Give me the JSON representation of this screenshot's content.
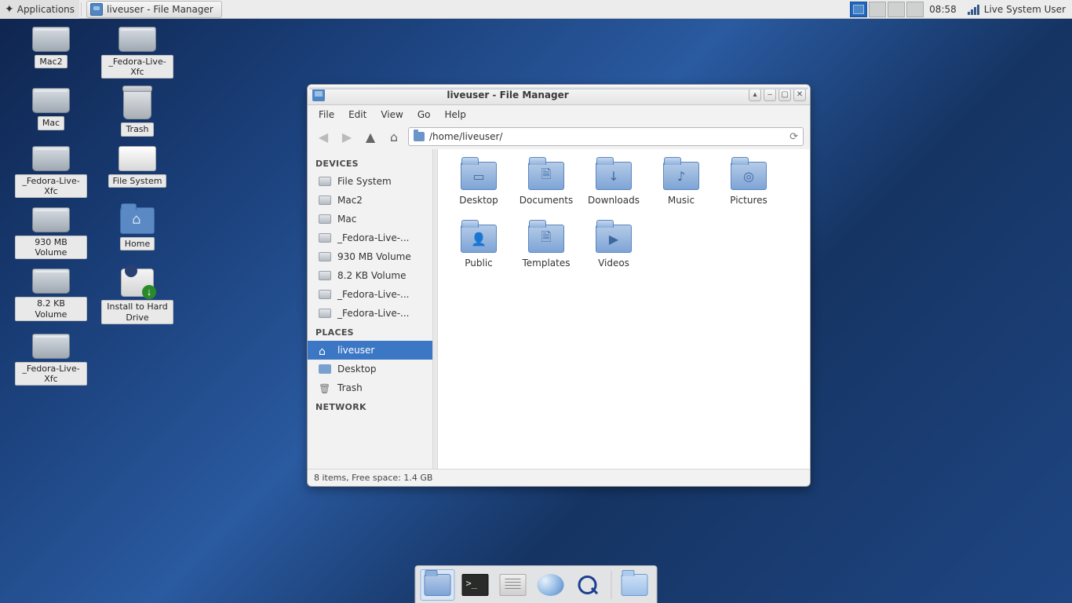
{
  "panel": {
    "apps_label": "Applications",
    "task_item": "liveuser - File Manager",
    "clock": "08:58",
    "user": "Live System User"
  },
  "desktop": {
    "icons": [
      {
        "label": "Mac2",
        "type": "drive"
      },
      {
        "label": "_Fedora-Live-Xfc",
        "type": "drive"
      },
      {
        "label": "Mac",
        "type": "drive"
      },
      {
        "label": "Trash",
        "type": "trash"
      },
      {
        "label": "_Fedora-Live-Xfc",
        "type": "drive"
      },
      {
        "label": "File System",
        "type": "white-drive"
      },
      {
        "label": "930 MB Volume",
        "type": "drive"
      },
      {
        "label": "Home",
        "type": "home-folder"
      },
      {
        "label": "8.2 KB Volume",
        "type": "drive"
      },
      {
        "label": "Install to Hard Drive",
        "type": "installer"
      },
      {
        "label": "_Fedora-Live-Xfc",
        "type": "drive"
      }
    ]
  },
  "fm": {
    "title": "liveuser - File Manager",
    "menu": [
      "File",
      "Edit",
      "View",
      "Go",
      "Help"
    ],
    "path": "/home/liveuser/",
    "sidebar": {
      "devices_header": "DEVICES",
      "devices": [
        "File System",
        "Mac2",
        "Mac",
        "_Fedora-Live-...",
        "930 MB Volume",
        "8.2 KB Volume",
        "_Fedora-Live-...",
        "_Fedora-Live-..."
      ],
      "places_header": "PLACES",
      "places": [
        {
          "label": "liveuser",
          "icon": "home",
          "selected": true
        },
        {
          "label": "Desktop",
          "icon": "desk",
          "selected": false
        },
        {
          "label": "Trash",
          "icon": "trash",
          "selected": false
        }
      ],
      "network_header": "NETWORK"
    },
    "folders": [
      {
        "name": "Desktop",
        "glyph": "▭"
      },
      {
        "name": "Documents",
        "glyph": "🗎"
      },
      {
        "name": "Downloads",
        "glyph": "↓"
      },
      {
        "name": "Music",
        "glyph": "♪"
      },
      {
        "name": "Pictures",
        "glyph": "◎"
      },
      {
        "name": "Public",
        "glyph": "👤"
      },
      {
        "name": "Templates",
        "glyph": "🗎"
      },
      {
        "name": "Videos",
        "glyph": "▶"
      }
    ],
    "status": "8 items, Free space: 1.4 GB"
  },
  "dock": {
    "items": [
      {
        "name": "file-manager",
        "active": true,
        "icon": "folder"
      },
      {
        "name": "terminal",
        "active": false,
        "icon": "term"
      },
      {
        "name": "file-archiver",
        "active": false,
        "icon": "files"
      },
      {
        "name": "web-browser",
        "active": false,
        "icon": "web"
      },
      {
        "name": "search",
        "active": false,
        "icon": "search"
      },
      {
        "name": "folder",
        "active": false,
        "icon": "plainfolder",
        "sep_before": true
      }
    ]
  }
}
